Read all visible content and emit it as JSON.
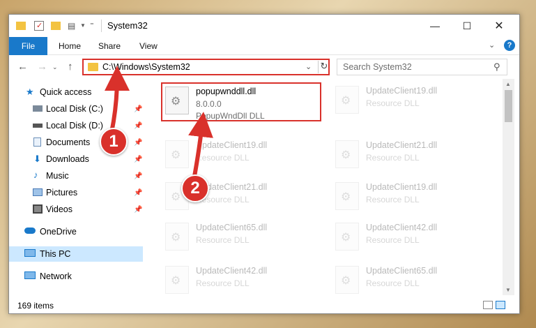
{
  "window": {
    "title": "System32"
  },
  "ribbon": {
    "tabs": [
      {
        "label": "File"
      },
      {
        "label": "Home"
      },
      {
        "label": "Share"
      },
      {
        "label": "View"
      }
    ]
  },
  "navigation": {
    "address": "C:\\Windows\\System32",
    "search_placeholder": "Search System32"
  },
  "sidebar": {
    "items": [
      {
        "label": "Quick access",
        "icon": "star-icon"
      },
      {
        "label": "Local Disk (C:)",
        "icon": "drive-icon"
      },
      {
        "label": "Local Disk (D:)",
        "icon": "drive-icon"
      },
      {
        "label": "Documents",
        "icon": "documents-icon"
      },
      {
        "label": "Downloads",
        "icon": "download-icon"
      },
      {
        "label": "Music",
        "icon": "music-icon"
      },
      {
        "label": "Pictures",
        "icon": "pictures-icon"
      },
      {
        "label": "Videos",
        "icon": "videos-icon"
      },
      {
        "label": "OneDrive",
        "icon": "cloud-icon"
      },
      {
        "label": "This PC",
        "icon": "computer-icon"
      },
      {
        "label": "Network",
        "icon": "network-icon"
      }
    ]
  },
  "files": [
    {
      "name": "popupwnddll.dll",
      "line1": "8.0.0.0",
      "line2": "PopupWndDll DLL",
      "highlighted": true
    },
    {
      "name": "UpdateClient19.dll",
      "line1": "Resource DLL"
    },
    {
      "name": "UpdateClient19.dll",
      "line1": "Resource DLL"
    },
    {
      "name": "UpdateClient21.dll",
      "line1": "Resource DLL"
    },
    {
      "name": "UpdateClient21.dll",
      "line1": "Resource DLL"
    },
    {
      "name": "UpdateClient19.dll",
      "line1": "Resource DLL"
    },
    {
      "name": "UpdateClient65.dll",
      "line1": "Resource DLL"
    },
    {
      "name": "UpdateClient42.dll",
      "line1": "Resource DLL"
    },
    {
      "name": "UpdateClient42.dll",
      "line1": "Resource DLL"
    },
    {
      "name": "UpdateClient65.dll",
      "line1": "Resource DLL"
    }
  ],
  "status": {
    "item_count": "169 items"
  },
  "annotations": {
    "step1": "1",
    "step2": "2"
  },
  "colors": {
    "accent": "#1979ca",
    "highlight": "#d9312b",
    "selection": "#cce8ff"
  }
}
